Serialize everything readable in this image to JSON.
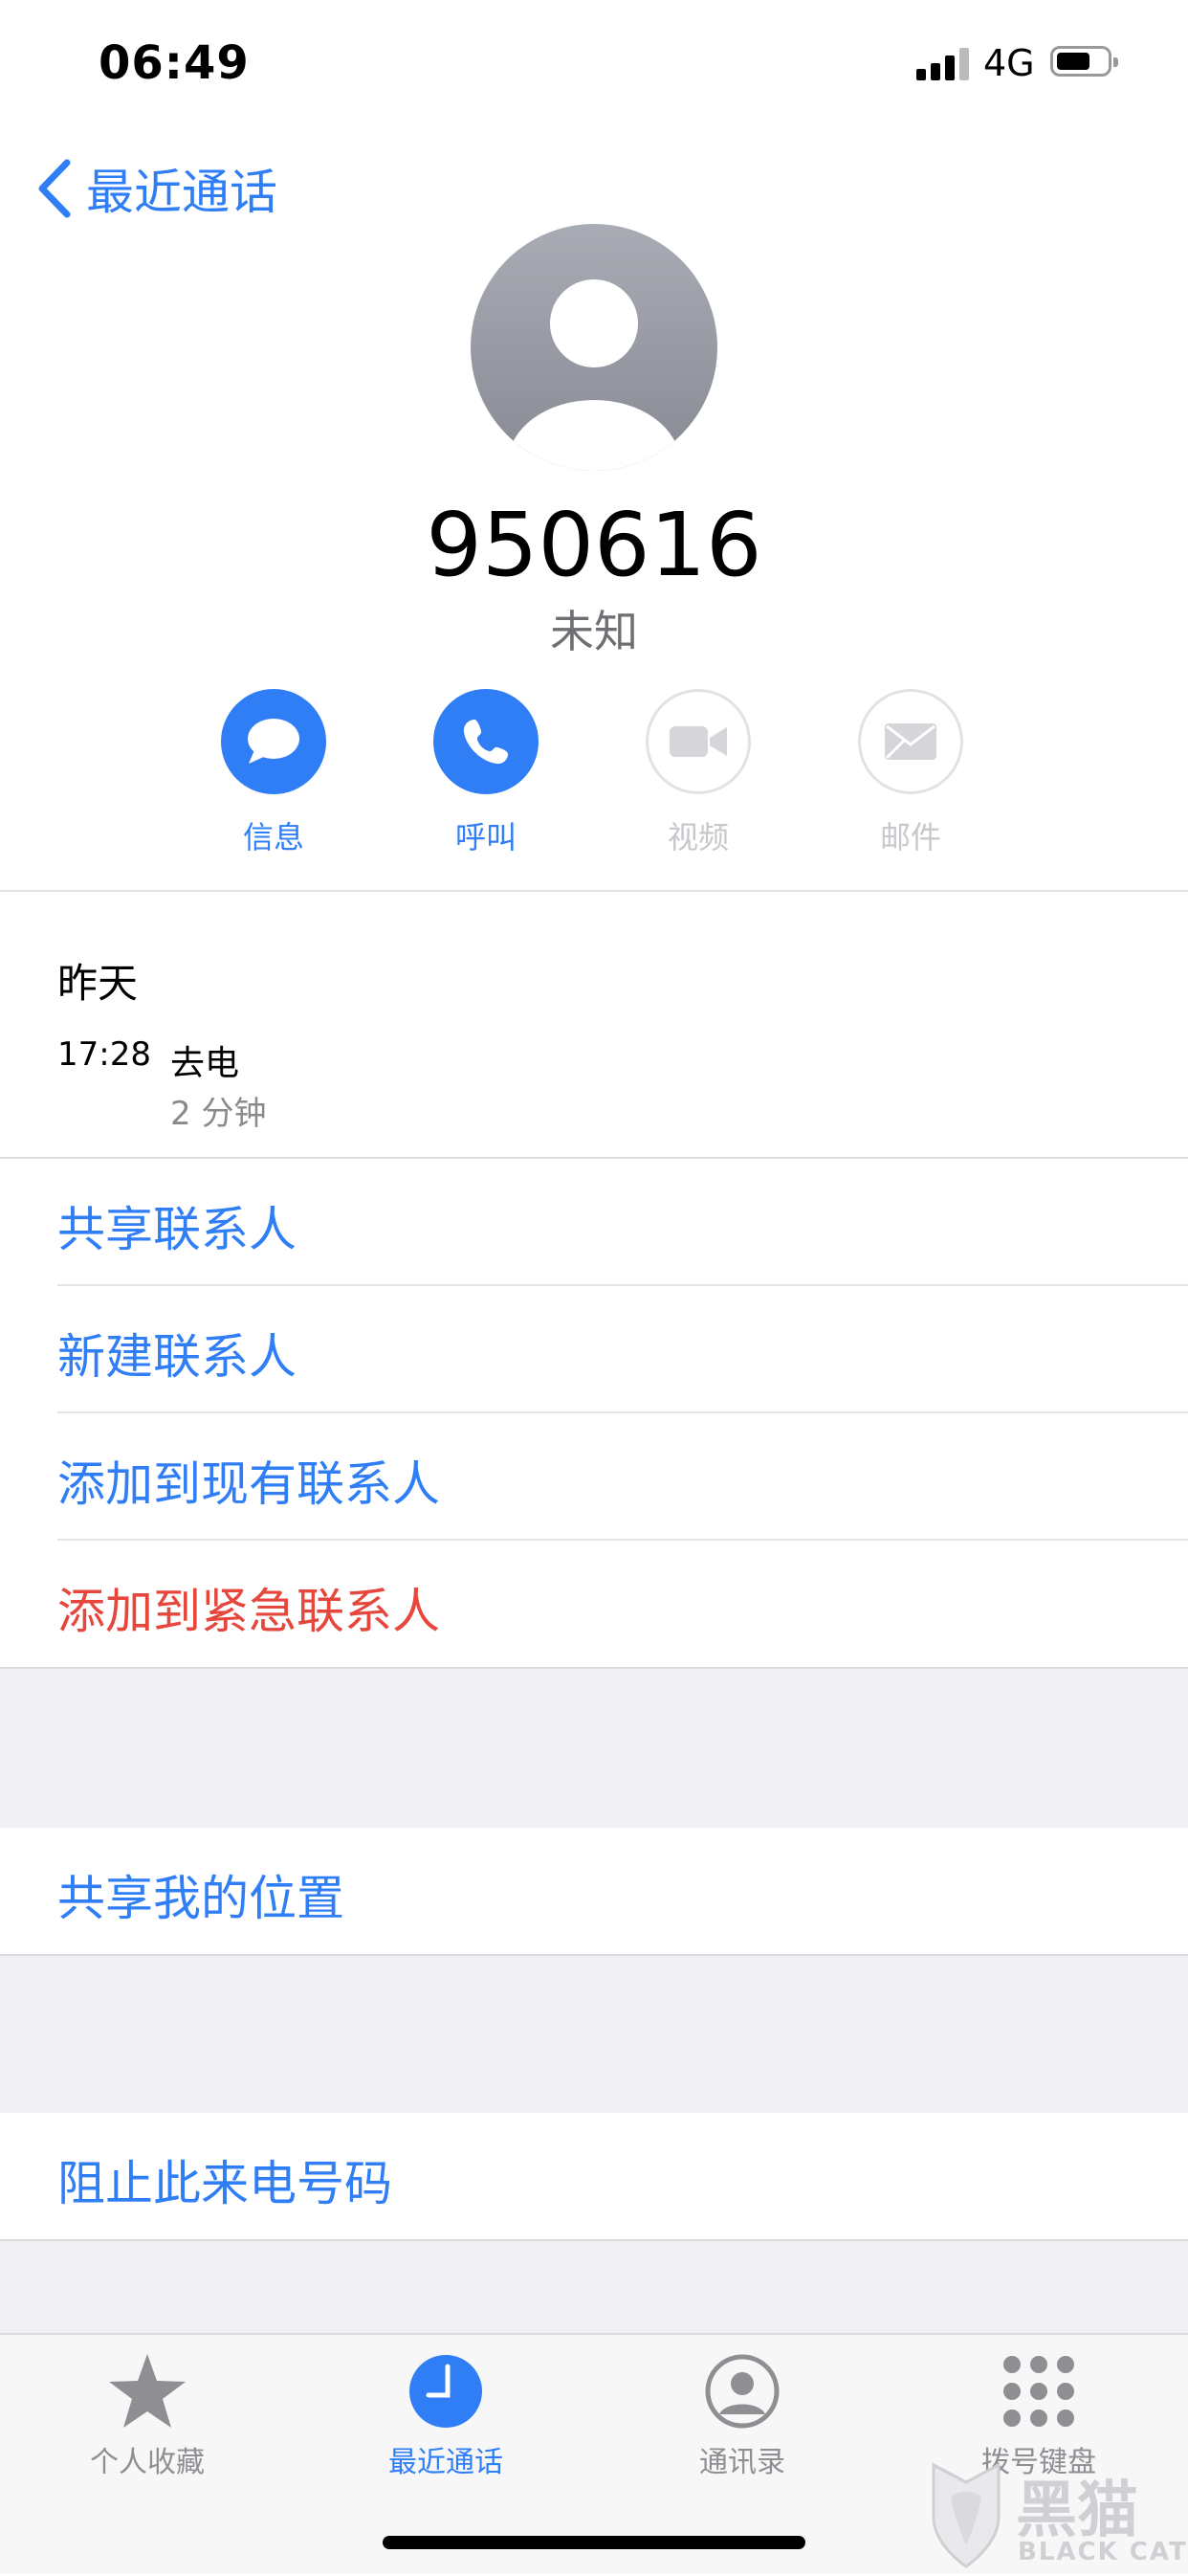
{
  "status_bar": {
    "time": "06:49",
    "network": "4G"
  },
  "nav": {
    "back_label": "最近通话"
  },
  "contact": {
    "number": "950616",
    "label": "未知"
  },
  "actions": [
    {
      "label": "信息",
      "icon": "message-icon",
      "enabled": true
    },
    {
      "label": "呼叫",
      "icon": "phone-icon",
      "enabled": true
    },
    {
      "label": "视频",
      "icon": "video-icon",
      "enabled": false
    },
    {
      "label": "邮件",
      "icon": "mail-icon",
      "enabled": false
    }
  ],
  "call_history": {
    "day": "昨天",
    "time": "17:28",
    "type": "去电",
    "duration": "2 分钟"
  },
  "options": {
    "share_contact": "共享联系人",
    "new_contact": "新建联系人",
    "add_existing": "添加到现有联系人",
    "add_emergency": "添加到紧急联系人",
    "share_location": "共享我的位置",
    "block_caller": "阻止此来电号码"
  },
  "tabbar": [
    {
      "label": "个人收藏",
      "icon": "star-icon",
      "active": false
    },
    {
      "label": "最近通话",
      "icon": "clock-icon",
      "active": true
    },
    {
      "label": "通讯录",
      "icon": "contacts-icon",
      "active": false
    },
    {
      "label": "拨号键盘",
      "icon": "keypad-icon",
      "active": false
    }
  ],
  "watermark": {
    "text_cn": "黑猫",
    "text_en": "BLACK CAT"
  },
  "colors": {
    "accent": "#2f7ef6",
    "destructive": "#e6463c",
    "group_bg": "#f1f1f5"
  }
}
